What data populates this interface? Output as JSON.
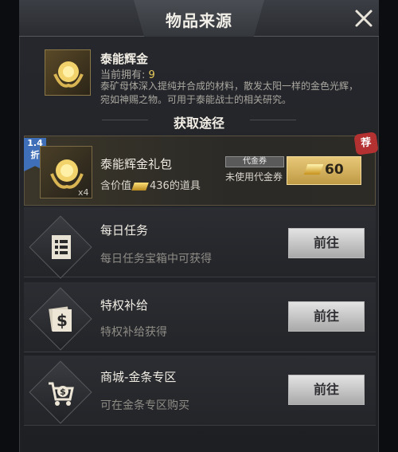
{
  "header": {
    "title": "物品来源",
    "close_icon": "close-icon"
  },
  "item": {
    "name": "泰能辉金",
    "owned_label": "当前拥有:",
    "owned_count": "9",
    "description": "泰矿母体深入提纯并合成的材料，散发太阳一样的金色光辉，宛如神赐之物。可用于泰能战士的相关研究。",
    "icon": "gold-flower-icon"
  },
  "section": {
    "title": "获取途径"
  },
  "gift": {
    "discount_value": "1.4",
    "discount_unit": "折",
    "name": "泰能辉金礼包",
    "quantity": "x4",
    "worth_prefix": "含价值",
    "worth_value": "436的道具",
    "coupon_badge": "代金券",
    "coupon_status": "未使用代金券",
    "price": "60",
    "stamp": "荐",
    "accent": "#e7c878"
  },
  "sources": [
    {
      "title": "每日任务",
      "subtitle": "日任务宝箱中可获得",
      "subtitle_prefix": "每",
      "button": "前往",
      "icon": "document-icon"
    },
    {
      "title": "特权补给",
      "subtitle": "特权补给获得",
      "button": "前往",
      "icon": "dollar-card-icon"
    },
    {
      "title": "商城-金条专区",
      "subtitle": "可在金条专区购买",
      "button": "前往",
      "icon": "shopping-cart-icon"
    }
  ]
}
